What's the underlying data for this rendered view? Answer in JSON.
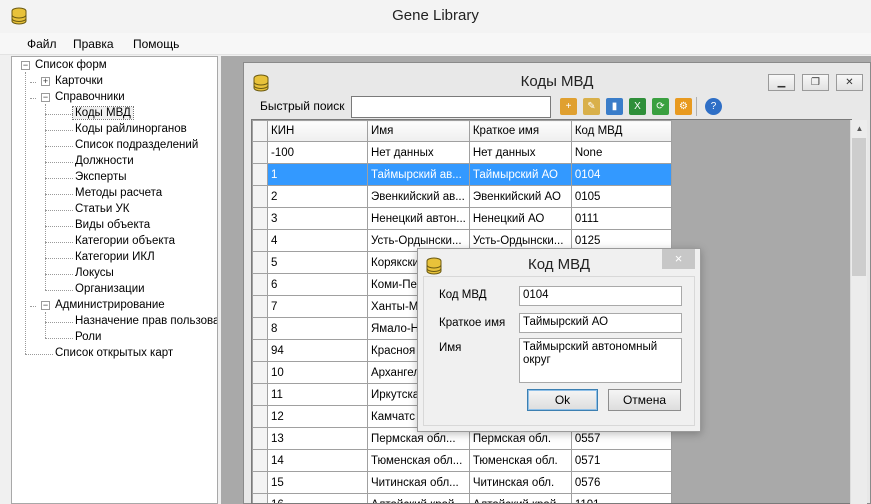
{
  "app": {
    "title": "Gene Library"
  },
  "menu": [
    "Файл",
    "Правка",
    "Помощь"
  ],
  "tree": {
    "root": "Список форм",
    "cards": "Карточки",
    "directories": "Справочники",
    "directory_items": [
      "Коды МВД",
      "Коды райлинорганов",
      "Список подразделений",
      "Должности",
      "Эксперты",
      "Методы расчета",
      "Статьи УК",
      "Виды объекта",
      "Категории объекта",
      "Категории ИКЛ",
      "Локусы",
      "Организации"
    ],
    "administration": "Администрирование",
    "admin_items": [
      "Назначение прав пользовате",
      "Роли"
    ],
    "open_maps": "Список открытых карт"
  },
  "child": {
    "title": "Коды МВД",
    "quick_search_label": "Быстрый поиск",
    "quick_search_value": "",
    "toolbar_icons": [
      "add-icon",
      "edit-icon",
      "delete-icon",
      "excel-icon",
      "refresh-icon",
      "settings-icon",
      "help-icon"
    ]
  },
  "grid": {
    "columns": [
      "КИН",
      "Имя",
      "Краткое имя",
      "Код МВД"
    ],
    "rows": [
      [
        "-100",
        "Нет данных",
        "Нет данных",
        "None"
      ],
      [
        "1",
        "Таймырский ав...",
        "Таймырский АО",
        "0104"
      ],
      [
        "2",
        "Эвенкийский ав...",
        "Эвенкийский АО",
        "0105"
      ],
      [
        "3",
        "Ненецкий автон...",
        "Ненецкий АО",
        "0111"
      ],
      [
        "4",
        "Усть-Ордынски...",
        "Усть-Ордынски...",
        "0125"
      ],
      [
        "5",
        "Корякски",
        "",
        ""
      ],
      [
        "6",
        "Коми-Пе",
        "",
        ""
      ],
      [
        "7",
        "Ханты-М",
        "",
        ""
      ],
      [
        "8",
        "Ямало-Н",
        "",
        ""
      ],
      [
        "94",
        "Красноя",
        "",
        ""
      ],
      [
        "10",
        "Архангел",
        "",
        ""
      ],
      [
        "11",
        "Иркутска",
        "",
        ""
      ],
      [
        "12",
        "Камчатс",
        "",
        ""
      ],
      [
        "13",
        "Пермская обл...",
        "Пермская обл.",
        "0557"
      ],
      [
        "14",
        "Тюменская обл...",
        "Тюменская обл.",
        "0571"
      ],
      [
        "15",
        "Читинская обл...",
        "Читинская обл.",
        "0576"
      ],
      [
        "16",
        "Алтайский край",
        "Алтайский край",
        "1101"
      ]
    ],
    "selected_row_index": 1
  },
  "dialog": {
    "title": "Код МВД",
    "code_label": "Код МВД",
    "code_value": "0104",
    "short_name_label": "Краткое имя",
    "short_name_value": "Таймырский АО",
    "name_label": "Имя",
    "name_value": "Таймырский автономный округ",
    "ok_label": "Ok",
    "cancel_label": "Отмена",
    "close_label": "×"
  },
  "colors": {
    "selection": "#3399ff",
    "mdi_background": "#a9a9a9"
  }
}
